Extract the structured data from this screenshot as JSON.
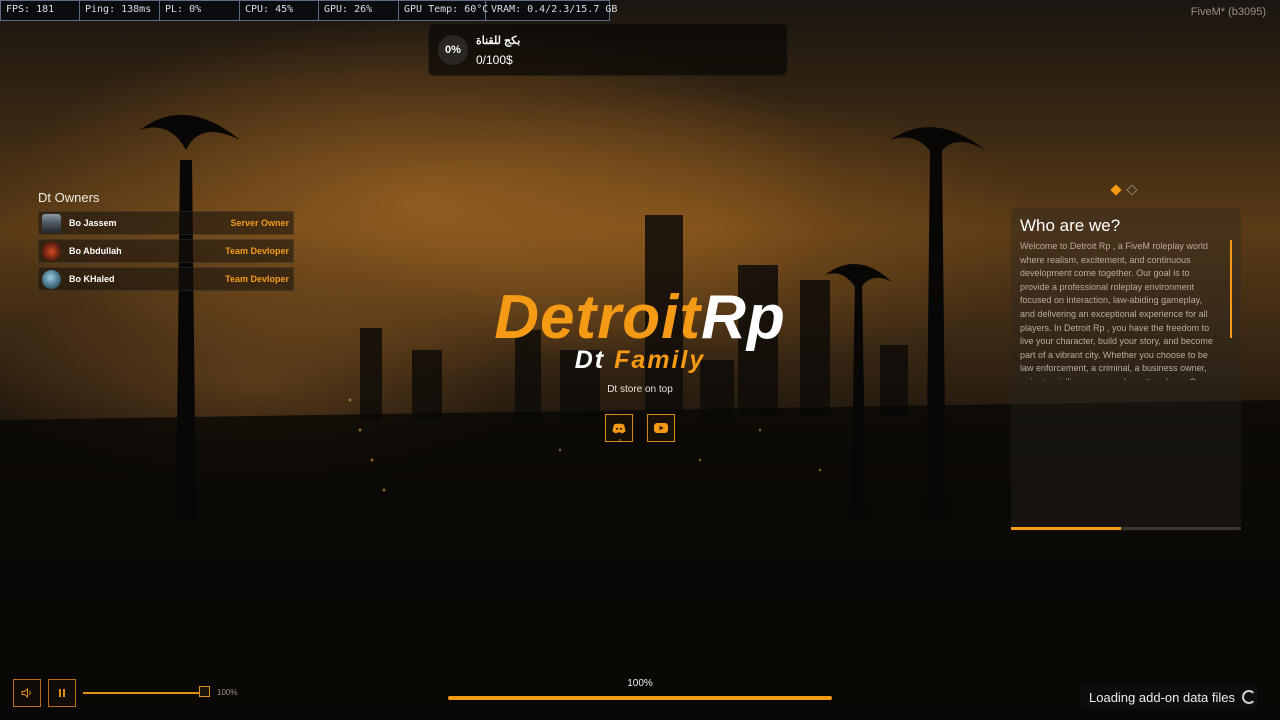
{
  "perf": {
    "fps": "FPS: 181",
    "ping": "Ping: 138ms",
    "pl": "PL: 0%",
    "cpu": "CPU: 45%",
    "gpu": "GPU: 26%",
    "gpu_temp": "GPU Temp: 60°C",
    "vram": "VRAM: 0.4/2.3/15.7 GB"
  },
  "client_label": "FiveM* (b3095)",
  "donation": {
    "percent": "0%",
    "title": "بكج للقناة",
    "amount": "0/100$"
  },
  "owners": {
    "title": "Dt Owners",
    "items": [
      {
        "name": "Bo Jassem",
        "role": "Server Owner"
      },
      {
        "name": "Bo Abdullah",
        "role": "Team Devloper"
      },
      {
        "name": "Bo KHaled",
        "role": "Team Devloper"
      }
    ]
  },
  "logo": {
    "part1": "Detroit",
    "part2": "Rp",
    "family1": "Dt",
    "family2": "Family"
  },
  "tagline": "Dt store on top",
  "social": {
    "icons": [
      "discord-icon",
      "youtube-icon"
    ]
  },
  "about": {
    "title": "Who are we?",
    "text": "Welcome to Detroit Rp , a FiveM roleplay world where realism, excitement, and continuous development come together. Our goal is to provide a professional roleplay environment focused on interaction, law-abiding gameplay, and delivering an exceptional experience for all players. In Detroit Rp , you have the freedom to live your character, build your story, and become part of a vibrant city. Whether you choose to be law enforcement, a criminal, a business owner, or just a civilian – every role matters here. Our admin",
    "slide_active": 0,
    "slide_count": 2,
    "progress_fraction": 0.48
  },
  "player": {
    "volume_percent": "100%",
    "volume_fraction": 1.0
  },
  "loading": {
    "percent_label": "100%",
    "fraction": 1.0,
    "status": "Loading add-on data files"
  },
  "colors": {
    "accent": "#f59a14"
  }
}
